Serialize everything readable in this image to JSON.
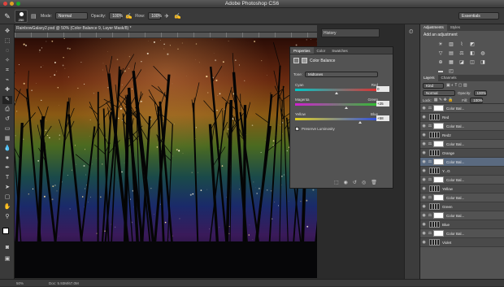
{
  "window": {
    "title": "Adobe Photoshop CS6"
  },
  "options_bar": {
    "brush_size": "250",
    "mode_label": "Mode:",
    "mode_value": "Normal",
    "opacity_label": "Opacity:",
    "opacity_value": "100%",
    "flow_label": "Flow:",
    "flow_value": "100%",
    "workspace": "Essentials"
  },
  "document": {
    "tab_title": "RainbowGalaxy2.psd @ 50% (Color Balance 9, Layer Mask/8) *",
    "status": "Doc: 5.93M/67.0M",
    "zoom": "50%"
  },
  "history_panel": {
    "label": "History"
  },
  "properties_panel": {
    "tabs": [
      "Properties",
      "Color",
      "Swatches"
    ],
    "title": "Color Balance",
    "tone_label": "Tone:",
    "tone_value": "Midtones",
    "sliders": [
      {
        "left": "Cyan",
        "right": "Red",
        "value": "0",
        "position": 0.5
      },
      {
        "left": "Magenta",
        "right": "Green",
        "value": "+25",
        "position": 0.62
      },
      {
        "left": "Yellow",
        "right": "Blue",
        "value": "+58",
        "position": 0.78
      }
    ],
    "preserve_luminosity": "Preserve Luminosity",
    "preserve_checked": true
  },
  "adjustments_panel": {
    "tabs": [
      "Adjustments",
      "Styles"
    ],
    "subtitle": "Add an adjustment",
    "icons": [
      "sun",
      "levels",
      "curves",
      "exposure",
      "triangle",
      "vibrance",
      "hue",
      "balance",
      "bw",
      "photofilter",
      "mixer",
      "lookup",
      "invert",
      "posterize",
      "threshold",
      "gradient",
      "selective"
    ]
  },
  "layers_panel": {
    "tabs": [
      "Layers",
      "Channels"
    ],
    "kind_label": "Kind",
    "blend_value": "Normal",
    "opacity_label": "Opacity:",
    "opacity_value": "100%",
    "lock_label": "Lock:",
    "fill_label": "Fill:",
    "fill_value": "100%",
    "layers": [
      {
        "name": "Color Bal...",
        "type": "adj",
        "selected": false
      },
      {
        "name": "Red",
        "type": "group",
        "selected": false
      },
      {
        "name": "Color Bal...",
        "type": "adj",
        "selected": false
      },
      {
        "name": "Red2",
        "type": "group",
        "selected": false
      },
      {
        "name": "Color Bal...",
        "type": "adj",
        "selected": false
      },
      {
        "name": "Orange",
        "type": "group",
        "selected": false
      },
      {
        "name": "Color Bal...",
        "type": "adj",
        "selected": true
      },
      {
        "name": "Y...G",
        "type": "group",
        "selected": false
      },
      {
        "name": "Color Bal...",
        "type": "adj",
        "selected": false
      },
      {
        "name": "Yellow",
        "type": "group",
        "selected": false
      },
      {
        "name": "Color Bal...",
        "type": "adj",
        "selected": false
      },
      {
        "name": "Green",
        "type": "group",
        "selected": false
      },
      {
        "name": "Color Bal...",
        "type": "adj",
        "selected": false
      },
      {
        "name": "Blue",
        "type": "group",
        "selected": false
      },
      {
        "name": "Color Bal...",
        "type": "adj",
        "selected": false
      },
      {
        "name": "Violet",
        "type": "group",
        "selected": false
      }
    ]
  },
  "colors": {
    "accent": "#5a6a80",
    "panel": "#535353",
    "chrome": "#3a3a3a"
  }
}
